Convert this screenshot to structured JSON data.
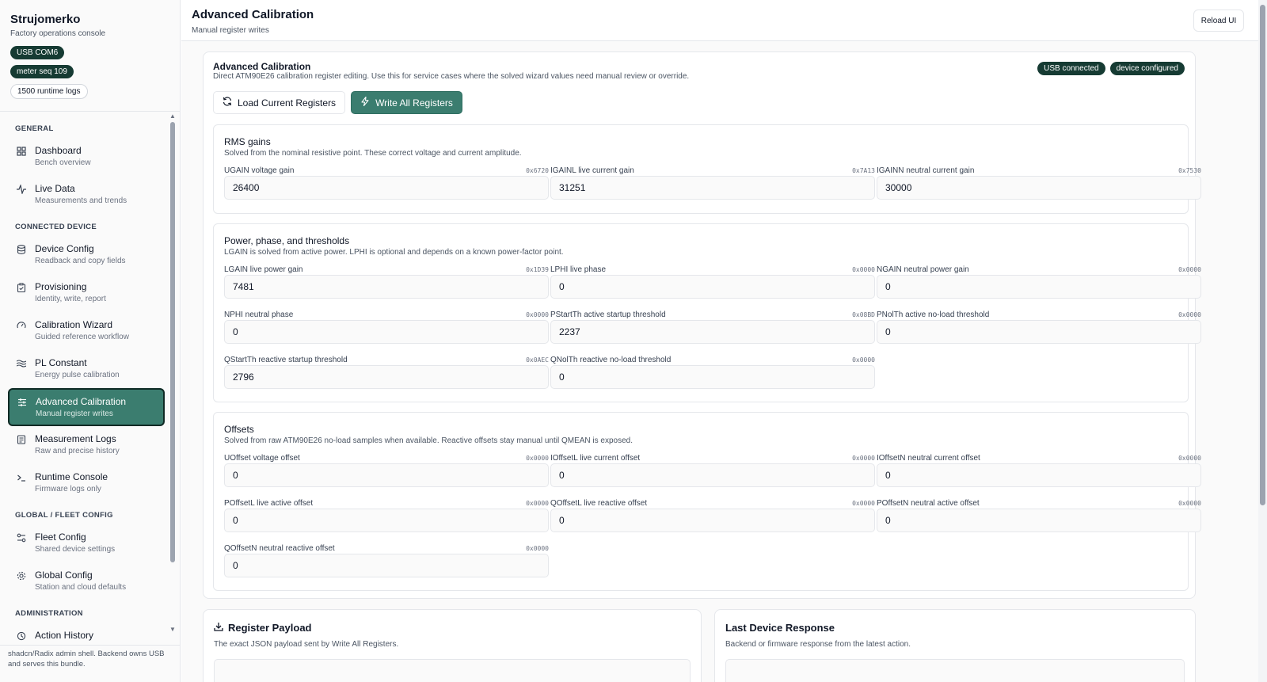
{
  "brand": {
    "title": "Strujomerko",
    "subtitle": "Factory operations console",
    "badges": [
      "USB COM6",
      "meter seq 109",
      "1500 runtime logs"
    ]
  },
  "nav": {
    "sections": [
      {
        "label": "GENERAL",
        "items": [
          {
            "title": "Dashboard",
            "sub": "Bench overview",
            "icon": "dashboard-icon"
          },
          {
            "title": "Live Data",
            "sub": "Measurements and trends",
            "icon": "activity-icon"
          }
        ]
      },
      {
        "label": "CONNECTED DEVICE",
        "items": [
          {
            "title": "Device Config",
            "sub": "Readback and copy fields",
            "icon": "database-icon"
          },
          {
            "title": "Provisioning",
            "sub": "Identity, write, report",
            "icon": "clipboard-icon"
          },
          {
            "title": "Calibration Wizard",
            "sub": "Guided reference workflow",
            "icon": "gauge-icon"
          },
          {
            "title": "PL Constant",
            "sub": "Energy pulse calibration",
            "icon": "waves-icon"
          },
          {
            "title": "Advanced Calibration",
            "sub": "Manual register writes",
            "icon": "sliders-icon"
          },
          {
            "title": "Measurement Logs",
            "sub": "Raw and precise history",
            "icon": "logs-icon"
          },
          {
            "title": "Runtime Console",
            "sub": "Firmware logs only",
            "icon": "terminal-icon"
          }
        ]
      },
      {
        "label": "GLOBAL / FLEET CONFIG",
        "items": [
          {
            "title": "Fleet Config",
            "sub": "Shared device settings",
            "icon": "fleet-icon"
          },
          {
            "title": "Global Config",
            "sub": "Station and cloud defaults",
            "icon": "gear-icon"
          }
        ]
      },
      {
        "label": "ADMINISTRATION",
        "items": [
          {
            "title": "Action History",
            "sub": "",
            "icon": "history-icon"
          }
        ]
      }
    ]
  },
  "sidebar_footer": "shadcn/Radix admin shell. Backend owns USB and serves this bundle.",
  "header": {
    "title": "Advanced Calibration",
    "subtitle": "Manual register writes",
    "reload_label": "Reload UI"
  },
  "card": {
    "title": "Advanced Calibration",
    "description": "Direct ATM90E26 calibration register editing. Use this for service cases where the solved wizard values need manual review or override.",
    "status": [
      "USB connected",
      "device configured"
    ],
    "load_label": "Load Current Registers",
    "write_label": "Write All Registers"
  },
  "groups": [
    {
      "title": "RMS gains",
      "description": "Solved from the nominal resistive point. These correct voltage and current amplitude.",
      "fields": [
        {
          "label": "UGAIN voltage gain",
          "addr": "0x6720",
          "value": "26400"
        },
        {
          "label": "IGAINL live current gain",
          "addr": "0x7A13",
          "value": "31251"
        },
        {
          "label": "IGAINN neutral current gain",
          "addr": "0x7530",
          "value": "30000"
        }
      ]
    },
    {
      "title": "Power, phase, and thresholds",
      "description": "LGAIN is solved from active power. LPHI is optional and depends on a known power-factor point.",
      "fields": [
        {
          "label": "LGAIN live power gain",
          "addr": "0x1D39",
          "value": "7481"
        },
        {
          "label": "LPHI live phase",
          "addr": "0x0000",
          "value": "0"
        },
        {
          "label": "NGAIN neutral power gain",
          "addr": "0x0000",
          "value": "0"
        },
        {
          "label": "NPHI neutral phase",
          "addr": "0x0000",
          "value": "0"
        },
        {
          "label": "PStartTh active startup threshold",
          "addr": "0x08BD",
          "value": "2237"
        },
        {
          "label": "PNolTh active no-load threshold",
          "addr": "0x0000",
          "value": "0"
        },
        {
          "label": "QStartTh reactive startup threshold",
          "addr": "0x0AEC",
          "value": "2796"
        },
        {
          "label": "QNolTh reactive no-load threshold",
          "addr": "0x0000",
          "value": "0"
        }
      ]
    },
    {
      "title": "Offsets",
      "description": "Solved from raw ATM90E26 no-load samples when available. Reactive offsets stay manual until QMEAN is exposed.",
      "fields": [
        {
          "label": "UOffset voltage offset",
          "addr": "0x0000",
          "value": "0"
        },
        {
          "label": "IOffsetL live current offset",
          "addr": "0x0000",
          "value": "0"
        },
        {
          "label": "IOffsetN neutral current offset",
          "addr": "0x0000",
          "value": "0"
        },
        {
          "label": "POffsetL live active offset",
          "addr": "0x0000",
          "value": "0"
        },
        {
          "label": "QOffsetL live reactive offset",
          "addr": "0x0000",
          "value": "0"
        },
        {
          "label": "POffsetN neutral active offset",
          "addr": "0x0000",
          "value": "0"
        },
        {
          "label": "QOffsetN neutral reactive offset",
          "addr": "0x0000",
          "value": "0"
        }
      ]
    }
  ],
  "payload": {
    "title": "Register Payload",
    "description": "The exact JSON payload sent by Write All Registers."
  },
  "response": {
    "title": "Last Device Response",
    "description": "Backend or firmware response from the latest action."
  },
  "colors": {
    "accent": "#3b7d6f",
    "badge_dark": "#163b33"
  }
}
